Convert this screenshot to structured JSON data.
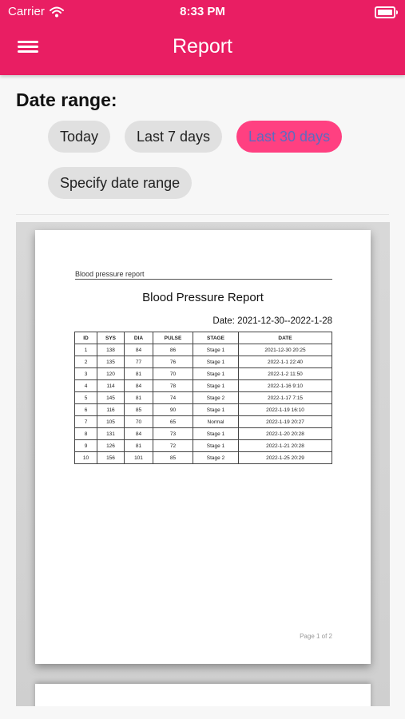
{
  "status_bar": {
    "carrier": "Carrier",
    "time": "8:33 PM"
  },
  "app_bar": {
    "title": "Report"
  },
  "date_range": {
    "label": "Date range:",
    "options": [
      "Today",
      "Last 7 days",
      "Last 30 days",
      "Specify date range"
    ],
    "selected": "Last 30 days"
  },
  "report": {
    "header": "Blood pressure report",
    "title": "Blood Pressure Report",
    "date": "Date: 2021-12-30--2022-1-28",
    "columns": [
      "ID",
      "SYS",
      "DIA",
      "PULSE",
      "STAGE",
      "DATE"
    ],
    "rows": [
      [
        "1",
        "138",
        "84",
        "86",
        "Stage 1",
        "2021-12-30 20:25"
      ],
      [
        "2",
        "135",
        "77",
        "76",
        "Stage 1",
        "2022-1-1 22:40"
      ],
      [
        "3",
        "120",
        "81",
        "70",
        "Stage 1",
        "2022-1-2 11:50"
      ],
      [
        "4",
        "114",
        "84",
        "78",
        "Stage 1",
        "2022-1-16 9:10"
      ],
      [
        "5",
        "145",
        "81",
        "74",
        "Stage 2",
        "2022-1-17 7:15"
      ],
      [
        "6",
        "116",
        "85",
        "90",
        "Stage 1",
        "2022-1-19 16:10"
      ],
      [
        "7",
        "105",
        "70",
        "65",
        "Normal",
        "2022-1-19 20:27"
      ],
      [
        "8",
        "131",
        "84",
        "73",
        "Stage 1",
        "2022-1-20 20:28"
      ],
      [
        "9",
        "126",
        "81",
        "72",
        "Stage 1",
        "2022-1-21 20:28"
      ],
      [
        "10",
        "156",
        "101",
        "85",
        "Stage 2",
        "2022-1-25 20:29"
      ]
    ],
    "page_number": "Page 1 of 2"
  },
  "colors": {
    "accent": "#e91e63",
    "chip_selected": "#ff4081",
    "chip_selected_text": "#5c6bc0",
    "chip": "#e0e0e0"
  },
  "icons": {
    "menu": "hamburger-icon",
    "wifi": "wifi-icon",
    "battery": "battery-icon"
  }
}
